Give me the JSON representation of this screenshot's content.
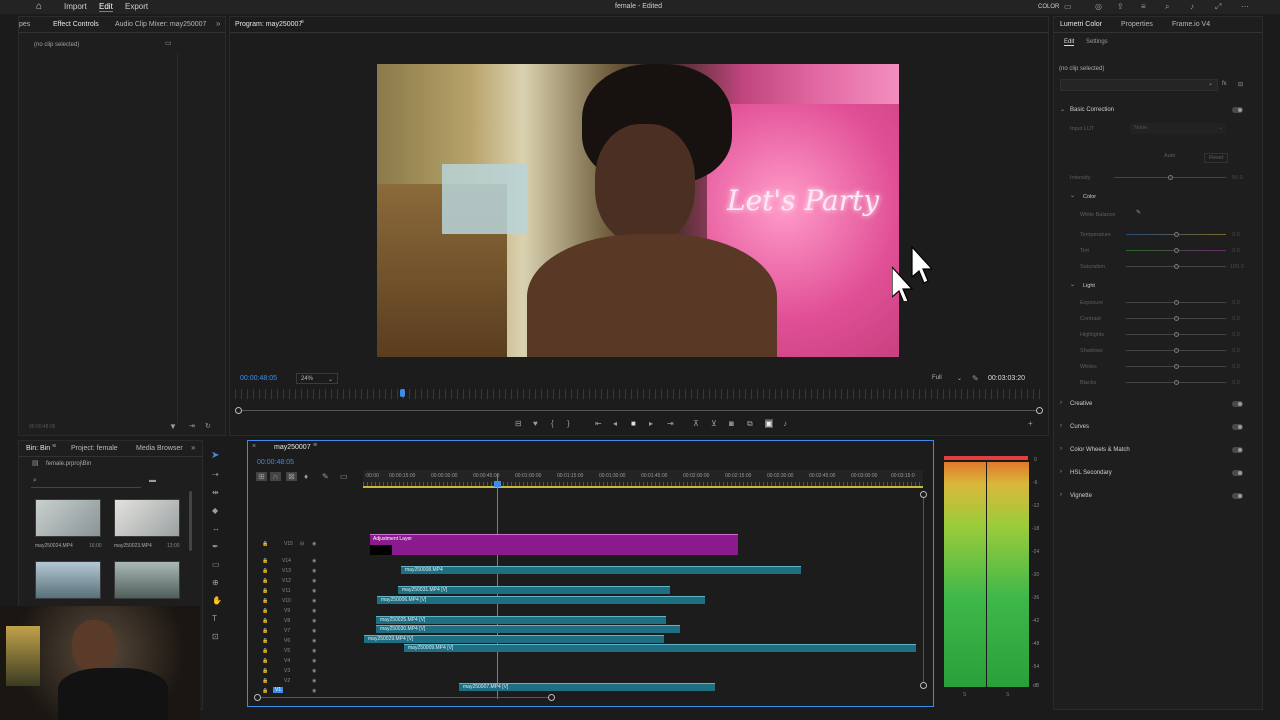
{
  "app": {
    "title": "female - Edited",
    "menu": [
      "Import",
      "Edit",
      "Export"
    ],
    "active_menu": "Edit",
    "workspace_label": "COLOR"
  },
  "effect_controls": {
    "tabs": [
      "pes",
      "Effect Controls",
      "Audio Clip Mixer: may250007"
    ],
    "empty_text": "(no clip selected)",
    "time": "00:00:48:05"
  },
  "program_monitor": {
    "title": "Program: may250007",
    "timecode": "00:00:48:05",
    "zoom": "24%",
    "quality": "Full",
    "duration": "00:03:03:20",
    "overlay_text": "Let's Party",
    "playhead_fraction": 0.2
  },
  "project_panel": {
    "tabs": [
      "Bin: Bin",
      "Project: female",
      "Media Browser"
    ],
    "path": "female.prproj\\Bin",
    "items": [
      {
        "name": "may250024.MP4",
        "duration": "16;00"
      },
      {
        "name": "may250023.MP4",
        "duration": "13;00"
      },
      {
        "name": "",
        "duration": ""
      },
      {
        "name": "",
        "duration": ""
      }
    ]
  },
  "timeline": {
    "title": "may250007",
    "timecode": "00:00:48:05",
    "ruler": [
      ":00:00",
      "00:00:15:00",
      "00:00:30:00",
      "00:00:45:00",
      "00:01:00:00",
      "00:01:15:00",
      "00:01:30:00",
      "00:01:45:00",
      "00:02:00:00",
      "00:02:15:00",
      "00:02:30:00",
      "00:02:45:00",
      "00:03:00:00",
      "00:03:15:0"
    ],
    "tracks": [
      "V15",
      "V14",
      "V13",
      "V12",
      "V11",
      "V10",
      "V9",
      "V8",
      "V7",
      "V6",
      "V5",
      "V4",
      "V3",
      "V2",
      "V1"
    ],
    "adjustment_layer": "Adjustment Layer",
    "clips": [
      "may250008.MP4",
      "may250031.MP4 [V]",
      "may250006.MP4 [V]",
      "may250025.MP4 [V]",
      "may250030.MP4 [V]",
      "may250029.MP4 [V]",
      "may250009.MP4 [V]",
      "may250007.MP4 [V]"
    ]
  },
  "meter": {
    "scale": [
      "0",
      "-6",
      "-12",
      "-18",
      "-24",
      "-30",
      "-36",
      "-42",
      "-48",
      "-54",
      "dB"
    ],
    "bottom": [
      "S",
      "S"
    ]
  },
  "lumetri": {
    "tabs": [
      "Lumetri Color",
      "Properties",
      "Frame.io V4"
    ],
    "subtabs": [
      "Edit",
      "Settings"
    ],
    "empty_text": "(no clip selected)",
    "basic_correction": "Basic Correction",
    "input_lut_label": "Input LUT",
    "input_lut_value": "None",
    "auto": "Auto",
    "reset": "Reset",
    "intensity": "Intensity",
    "color": "Color",
    "white_balance": "White Balance",
    "temperature": "Temperature",
    "tint": "Tint",
    "saturation": "Saturation",
    "light": "Light",
    "light_controls": [
      "Exposure",
      "Contrast",
      "Highlights",
      "Shadows",
      "Whites",
      "Blacks"
    ],
    "values": {
      "intensity": "50.0",
      "temperature": "0.0",
      "tint": "0.0",
      "saturation": "100.0",
      "light": [
        "0.0",
        "0.0",
        "0.0",
        "0.0",
        "0.0",
        "0.0"
      ]
    },
    "sections": [
      "Creative",
      "Curves",
      "Color Wheels & Match",
      "HSL Secondary",
      "Vignette"
    ]
  },
  "colors": {
    "accent": "#3d8de8",
    "clip": "#1f6f82",
    "adjustment": "#8a1a8e",
    "playhead": "#3d8de8"
  }
}
